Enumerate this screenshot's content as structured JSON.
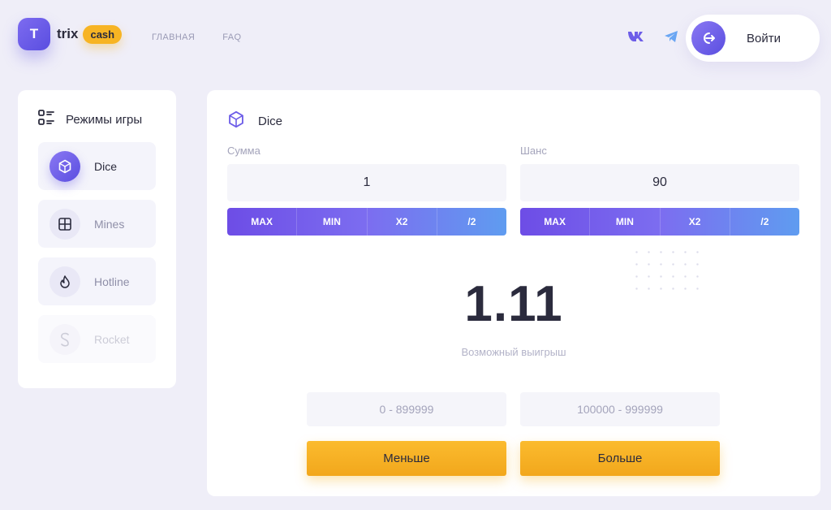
{
  "brand": {
    "badge": "T",
    "word": "trix",
    "pill": "cash",
    "accent": "#6d5de8",
    "gold": "#f7b423"
  },
  "nav": {
    "home": "ГЛАВНАЯ",
    "faq": "FAQ"
  },
  "socials": [
    "vk-icon",
    "telegram-icon"
  ],
  "login": {
    "label": "Войти"
  },
  "sidebar": {
    "title": "Режимы игры",
    "items": [
      {
        "label": "Dice",
        "icon": "dice-icon",
        "active": true
      },
      {
        "label": "Mines",
        "icon": "grid-icon",
        "active": false
      },
      {
        "label": "Hotline",
        "icon": "flame-icon",
        "active": false
      },
      {
        "label": "Rocket",
        "icon": "rocket-icon",
        "active": false,
        "dimmed": true
      }
    ]
  },
  "game": {
    "title": "Dice",
    "amount": {
      "label": "Сумма",
      "value": "1",
      "buttons": [
        "MAX",
        "MIN",
        "X2",
        "/2"
      ]
    },
    "chance": {
      "label": "Шанс",
      "value": "90",
      "buttons": [
        "MAX",
        "MIN",
        "X2",
        "/2"
      ]
    },
    "win_value": "1.11",
    "win_label": "Возможный выигрыш",
    "less": {
      "range": "0 - 899999",
      "label": "Меньше"
    },
    "more": {
      "range": "100000 - 999999",
      "label": "Больше"
    }
  }
}
